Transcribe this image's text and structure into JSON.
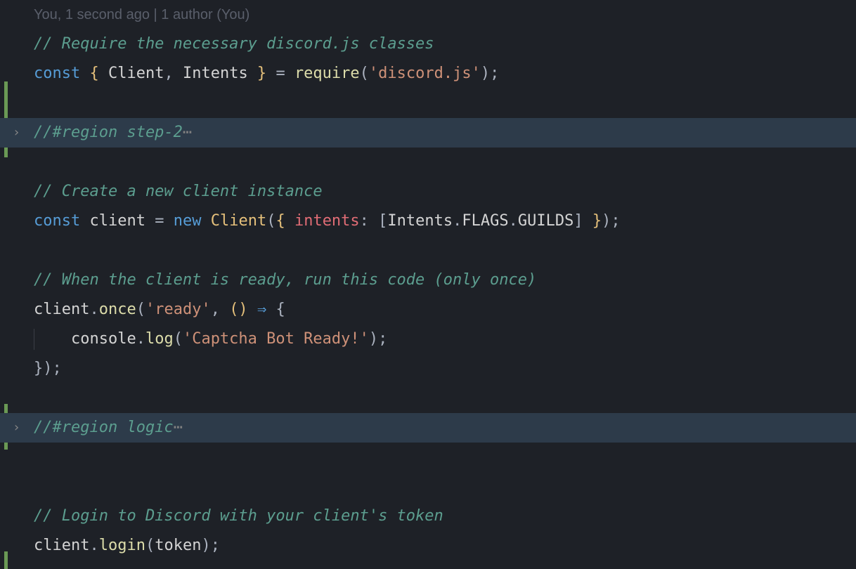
{
  "gitBlame": "You, 1 second ago | 1 author (You)",
  "code": {
    "comment1": "// Require the necessary discord.js classes",
    "line2": {
      "const": "const",
      "braceOpen": " { ",
      "client": "Client",
      "comma": ", ",
      "intents": "Intents",
      "braceClose": " } ",
      "eq": "= ",
      "require": "require",
      "paren1": "(",
      "str": "'discord.js'",
      "paren2": ")",
      "semi": ";"
    },
    "region1": "//#region step-2",
    "comment2": "// Create a new client instance",
    "line5": {
      "const": "const",
      "sp1": " ",
      "client": "client",
      "sp2": " ",
      "eq": "=",
      "sp3": " ",
      "new": "new",
      "sp4": " ",
      "Client": "Client",
      "p1": "(",
      "b1": "{ ",
      "intents": "intents",
      "colon": ":",
      "sp5": " ",
      "br1": "[",
      "Intents": "Intents",
      "dot1": ".",
      "FLAGS": "FLAGS",
      "dot2": ".",
      "GUILDS": "GUILDS",
      "br2": "]",
      "b2": " }",
      "p2": ")",
      "semi": ";"
    },
    "comment3": "// When the client is ready, run this code (only once)",
    "line7": {
      "client": "client",
      "dot": ".",
      "once": "once",
      "p1": "(",
      "str": "'ready'",
      "comma": ", ",
      "paren": "()",
      "sp": " ",
      "arrow": "⇒",
      "sp2": " ",
      "brace": "{"
    },
    "line8": {
      "indent": "    ",
      "console": "console",
      "dot": ".",
      "log": "log",
      "p1": "(",
      "str": "'Captcha Bot Ready!'",
      "p2": ")",
      "semi": ";"
    },
    "line9": "});",
    "region2": "//#region logic",
    "comment4": "// Login to Discord with your client's token",
    "line11": {
      "client": "client",
      "dot": ".",
      "login": "login",
      "p1": "(",
      "token": "token",
      "p2": ")",
      "semi": ";"
    }
  }
}
